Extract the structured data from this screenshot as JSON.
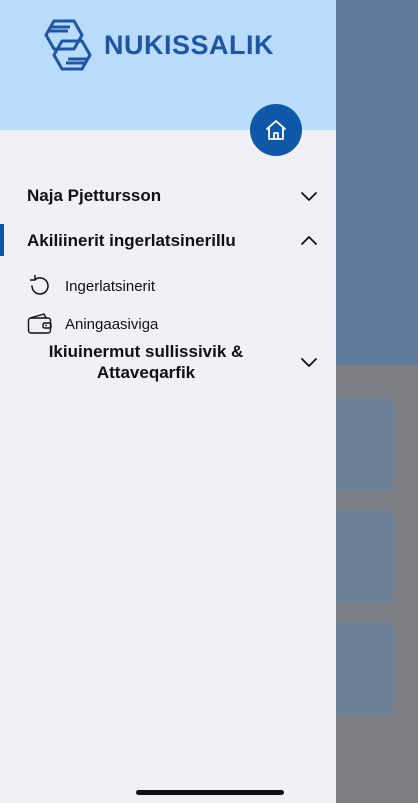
{
  "app": {
    "brand_name": "NUKISSALIK",
    "brand_color": "#1f56a3",
    "header_bg": "#b9dcfc",
    "accent": "#0f57a8"
  },
  "header": {
    "logo_icon": "nukissalik-logo-icon",
    "home_icon": "home-icon"
  },
  "menu": {
    "sections": [
      {
        "label": "Naja Pjettursson",
        "expanded": false,
        "icon": "chevron-down-icon"
      },
      {
        "label": "Akiliinerit ingerlatsinerillu",
        "expanded": true,
        "icon": "chevron-up-icon"
      },
      {
        "label": "Ikiuinermut sullissivik & Attaveqarfik",
        "expanded": false,
        "icon": "chevron-down-icon"
      }
    ],
    "sub_items": [
      {
        "label": "Ingerlatsinerit",
        "icon": "refresh-icon"
      },
      {
        "label": "Aningaasiviga",
        "icon": "wallet-icon"
      }
    ]
  }
}
